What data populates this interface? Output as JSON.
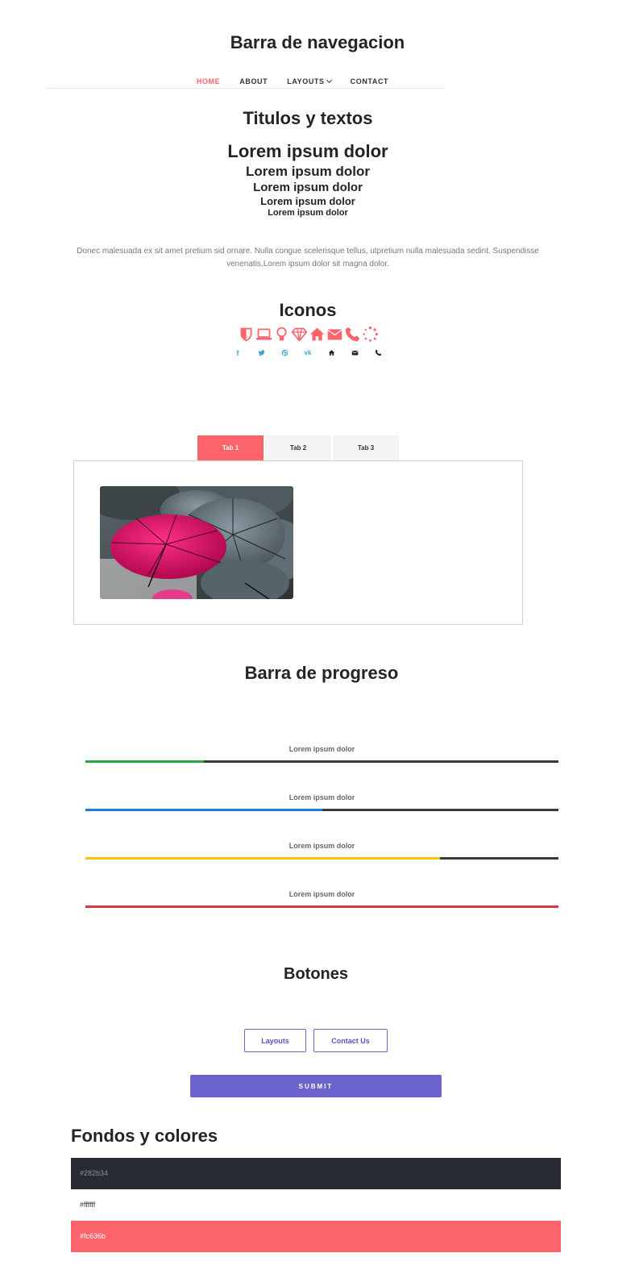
{
  "navbar_section": {
    "heading": "Barra de navegacion",
    "items": [
      {
        "label": "HOME",
        "active": true
      },
      {
        "label": "ABOUT",
        "active": false
      },
      {
        "label": "LAYOUTS",
        "active": false,
        "dropdown": true
      },
      {
        "label": "CONTACT",
        "active": false
      }
    ]
  },
  "titles_section": {
    "heading": "Titulos y textos",
    "h1": "Lorem ipsum dolor",
    "h2": "Lorem ipsum dolor",
    "h3": "Lorem ipsum dolor",
    "h4": "Lorem ipsum dolor",
    "h5": "Lorem ipsum dolor",
    "paragraph": "Donec malesuada ex sit amet pretium sid ornare. Nulla congue scelerisque tellus, utpretium nulla malesuada sedint. Suspendisse venenatis,Lorem ipsum dolor sit magna dolor."
  },
  "icons_section": {
    "heading": "Iconos",
    "accent_color": "#fc636b",
    "large_icons": [
      "shield-icon",
      "laptop-icon",
      "lightbulb-icon",
      "diamond-icon",
      "home-icon",
      "envelope-icon",
      "phone-icon",
      "spinner-icon"
    ],
    "small_icons": [
      {
        "name": "facebook-icon",
        "glyph": "f",
        "color": "#3ba7d6"
      },
      {
        "name": "twitter-icon",
        "glyph": "🐦",
        "color": "#3ba7d6"
      },
      {
        "name": "dribbble-icon",
        "glyph": "◎",
        "color": "#3ba7d6"
      },
      {
        "name": "vk-icon",
        "glyph": "vk",
        "color": "#3ba7d6"
      },
      {
        "name": "home-icon",
        "glyph": "⌂",
        "color": "#222222"
      },
      {
        "name": "envelope-icon",
        "glyph": "✉",
        "color": "#222222"
      },
      {
        "name": "phone-icon",
        "glyph": "✆",
        "color": "#222222"
      }
    ]
  },
  "tabs_section": {
    "tabs": [
      {
        "label": "Tab 1",
        "active": true
      },
      {
        "label": "Tab 2",
        "active": false
      },
      {
        "label": "Tab 3",
        "active": false
      }
    ]
  },
  "progress_section": {
    "heading": "Barra de progreso",
    "bars": [
      {
        "label": "Lorem ipsum dolor",
        "percent": 25,
        "color": "#28a745"
      },
      {
        "label": "Lorem ipsum dolor",
        "percent": 50,
        "color": "#1e7ce6"
      },
      {
        "label": "Lorem ipsum dolor",
        "percent": 75,
        "color": "#ffc107"
      },
      {
        "label": "Lorem ipsum dolor",
        "percent": 100,
        "color": "#dc3545"
      }
    ]
  },
  "buttons_section": {
    "heading": "Botones",
    "layouts_label": "Layouts",
    "contact_label": "Contact Us",
    "submit_label": "SUBMIT"
  },
  "colors_section": {
    "heading": "Fondos y colores",
    "swatches": [
      {
        "label": "#282b34",
        "bg": "#282b34",
        "text": "#8a8d96"
      },
      {
        "label": "#ffffff",
        "bg": "#ffffff",
        "text": "#333333"
      },
      {
        "label": "#fc636b",
        "bg": "#fc636b",
        "text": "#ffffff"
      }
    ]
  }
}
